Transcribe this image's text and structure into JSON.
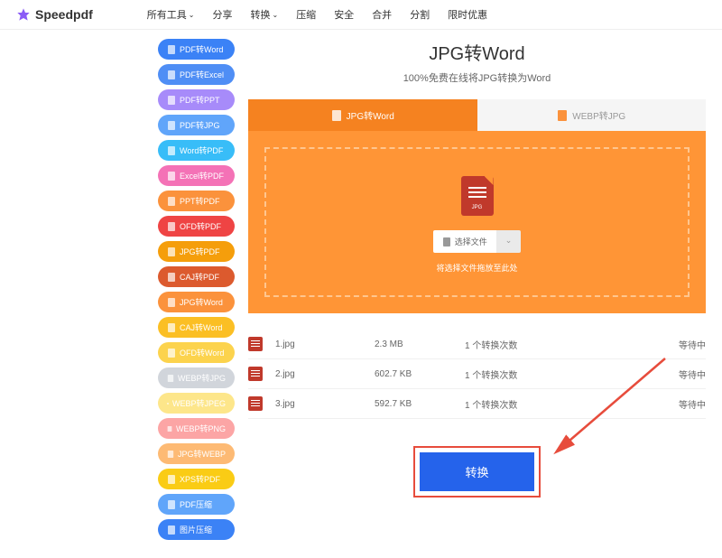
{
  "brand": "Speedpdf",
  "nav": [
    "所有工具",
    "分享",
    "转换",
    "压缩",
    "安全",
    "合并",
    "分割",
    "限时优惠"
  ],
  "sidebar": [
    {
      "label": "PDF转Word",
      "bg": "#3b82f6"
    },
    {
      "label": "PDF转Excel",
      "bg": "#4f8ef5"
    },
    {
      "label": "PDF转PPT",
      "bg": "#a78bfa"
    },
    {
      "label": "PDF转JPG",
      "bg": "#60a5fa"
    },
    {
      "label": "Word转PDF",
      "bg": "#38bdf8"
    },
    {
      "label": "Excel转PDF",
      "bg": "#f472b6"
    },
    {
      "label": "PPT转PDF",
      "bg": "#fb923c"
    },
    {
      "label": "OFD转PDF",
      "bg": "#ef4444"
    },
    {
      "label": "JPG转PDF",
      "bg": "#f59e0b"
    },
    {
      "label": "CAJ转PDF",
      "bg": "#dc5a2e"
    },
    {
      "label": "JPG转Word",
      "bg": "#fb923c"
    },
    {
      "label": "CAJ转Word",
      "bg": "#fbbf24"
    },
    {
      "label": "OFD转Word",
      "bg": "#fcd34d"
    },
    {
      "label": "WEBP转JPG",
      "bg": "#d1d5db"
    },
    {
      "label": "WEBP转JPEG",
      "bg": "#fde68a"
    },
    {
      "label": "WEBP转PNG",
      "bg": "#fca5a5"
    },
    {
      "label": "JPG转WEBP",
      "bg": "#fdba74"
    },
    {
      "label": "XPS转PDF",
      "bg": "#facc15"
    },
    {
      "label": "PDF压缩",
      "bg": "#60a5fa"
    },
    {
      "label": "图片压缩",
      "bg": "#3b82f6"
    }
  ],
  "page": {
    "title": "JPG转Word",
    "subtitle": "100%免费在线将JPG转换为Word"
  },
  "tabs": {
    "active": "JPG转Word",
    "inactive": "WEBP转JPG"
  },
  "upload": {
    "icon_label": "JPG",
    "select": "选择文件",
    "dropdown": "⌄",
    "drag_text": "将选择文件拖放至此处"
  },
  "files": [
    {
      "name": "1.jpg",
      "size": "2.3 MB",
      "count": "1 个转换次数",
      "status": "等待中"
    },
    {
      "name": "2.jpg",
      "size": "602.7 KB",
      "count": "1 个转换次数",
      "status": "等待中"
    },
    {
      "name": "3.jpg",
      "size": "592.7 KB",
      "count": "1 个转换次数",
      "status": "等待中"
    }
  ],
  "convert_label": "转换"
}
